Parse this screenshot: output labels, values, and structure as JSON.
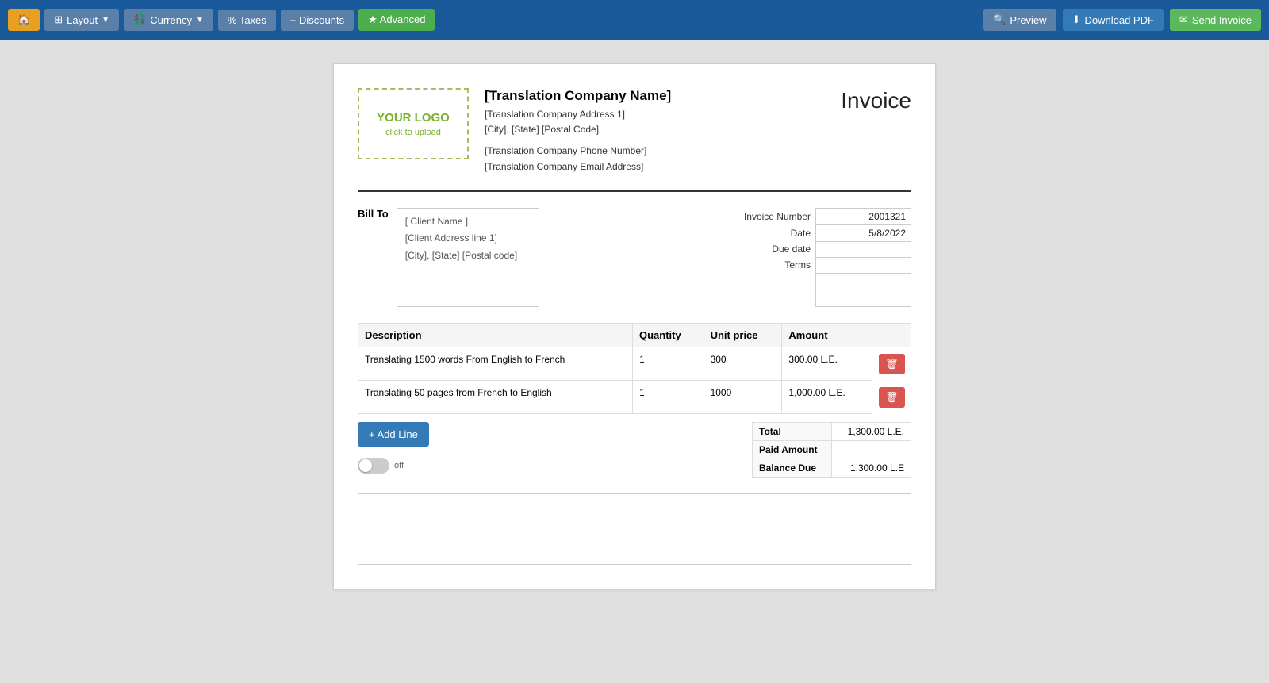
{
  "toolbar": {
    "home_label": "⌂",
    "layout_label": "Layout",
    "currency_label": "Currency",
    "taxes_label": "% Taxes",
    "discounts_label": "+ Discounts",
    "advanced_label": "★ Advanced",
    "preview_label": "Preview",
    "download_label": "Download PDF",
    "send_label": "Send Invoice"
  },
  "invoice": {
    "logo_text": "YOUR LOGO",
    "logo_sub": "click to upload",
    "company_name": "[Translation Company Name]",
    "company_address1": "[Translation Company Address 1]",
    "company_city": "[City], [State] [Postal Code]",
    "company_phone": "[Translation Company Phone Number]",
    "company_email": "[Translation Company Email Address]",
    "title": "Invoice",
    "bill_to_label": "Bill To",
    "client_name": "[ Client Name ]",
    "client_address1": "[Client Address line 1]",
    "client_city": "[City], [State] [Postal code]",
    "meta": {
      "invoice_number_label": "Invoice Number",
      "invoice_number_value": "2001321",
      "date_label": "Date",
      "date_value": "5/8/2022",
      "due_date_label": "Due date",
      "due_date_value": "",
      "terms_label": "Terms",
      "terms_value": ""
    },
    "table_headers": {
      "description": "Description",
      "quantity": "Quantity",
      "unit_price": "Unit price",
      "amount": "Amount"
    },
    "line_items": [
      {
        "description": "Translating 1500 words From English to French",
        "quantity": "1",
        "unit_price": "300",
        "amount": "300.00 L.E."
      },
      {
        "description": "Translating 50 pages from French to English",
        "quantity": "1",
        "unit_price": "1000",
        "amount": "1,000.00 L.E."
      }
    ],
    "add_line_label": "+ Add Line",
    "toggle_label": "off",
    "summary": {
      "total_label": "Total",
      "total_value": "1,300.00 L.E.",
      "paid_amount_label": "Paid Amount",
      "paid_amount_value": "",
      "balance_due_label": "Balance Due",
      "balance_due_value": "1,300.00 L.E"
    }
  }
}
